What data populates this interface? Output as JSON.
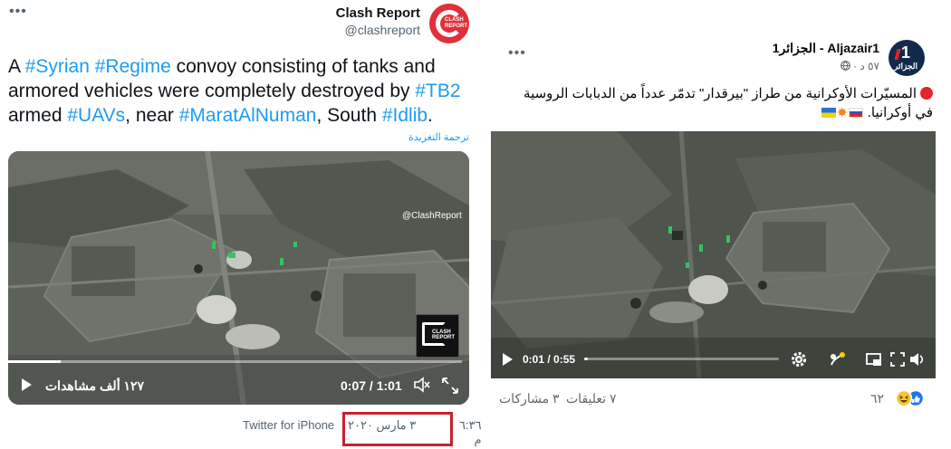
{
  "tweet": {
    "more_icon": "more-horizontal-icon",
    "author_name": "Clash Report",
    "handle": "@clashreport",
    "avatar_text": "CLASH REPORT",
    "text_parts": [
      {
        "text": "A ",
        "tag": false
      },
      {
        "text": "#Syrian",
        "tag": true
      },
      {
        "text": " ",
        "tag": false
      },
      {
        "text": "#Regime",
        "tag": true
      },
      {
        "text": " convoy consisting of tanks and armored vehicles were completely destroyed by ",
        "tag": false
      },
      {
        "text": "#TB2",
        "tag": true
      },
      {
        "text": " armed ",
        "tag": false
      },
      {
        "text": "#UAVs",
        "tag": true
      },
      {
        "text": ", near ",
        "tag": false
      },
      {
        "text": "#MaratAlNuman",
        "tag": true
      },
      {
        "text": ", South ",
        "tag": false
      },
      {
        "text": "#Idlib",
        "tag": true
      },
      {
        "text": ".",
        "tag": false
      }
    ],
    "translate_label": "ترجمة التغريدة",
    "video": {
      "watermark_text": "CLASH REPORT",
      "watermark_handle": "@ClashReport",
      "views": "١٢٧ ألف مشاهدات",
      "time": "0:07 / 1:01",
      "progress": 0.115
    },
    "meta": {
      "time": "٦:٣٦ م",
      "date": "٣ مارس ٢٠٢٠",
      "source": "Twitter for iPhone"
    },
    "colors": {
      "link": "#1d9bf0",
      "highlight_box": "#c8202f"
    }
  },
  "facebook": {
    "more_icon": "more-horizontal-icon",
    "page_name": "Aljazair1 - الجزائر1",
    "subtitle": "٥٧ د · ",
    "privacy_icon": "globe-icon",
    "avatar_text": "الجزائر",
    "avatar_number": "1",
    "post_text": "المسيّرات الأوكرانية من طراز \"بيرقدار\" تدمّر عدداً من الدبابات الروسية في أوكرانيا.",
    "video": {
      "time": "0:01 / 0:55",
      "progress": 0.02,
      "controls": [
        "settings-icon",
        "hd-icon",
        "miniplayer-icon",
        "fullscreen-icon",
        "volume-icon"
      ]
    },
    "stats": {
      "reactions": "٦٢",
      "comments": "٧ تعليقات",
      "shares": "٣ مشاركات"
    }
  }
}
